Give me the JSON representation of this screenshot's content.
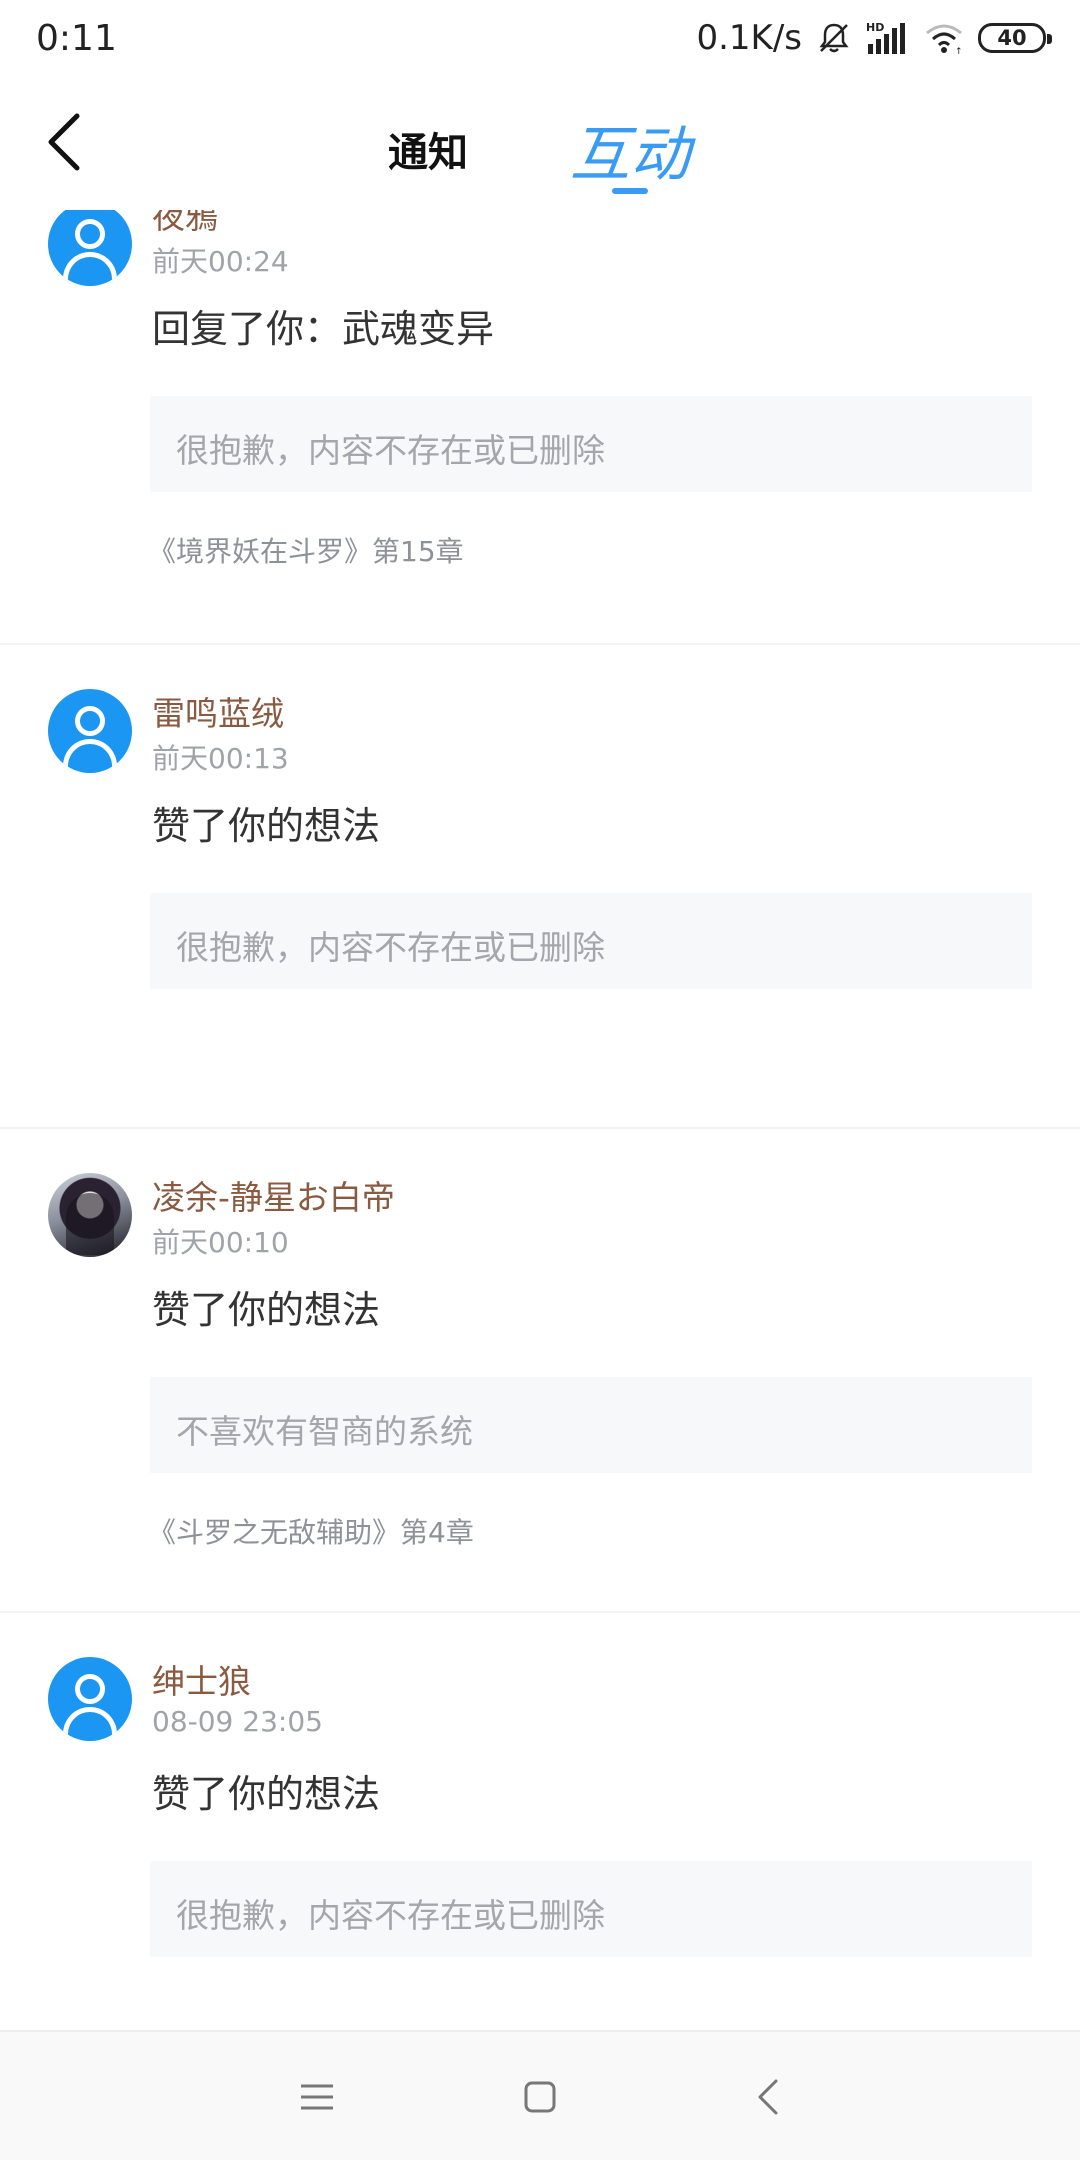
{
  "status_bar": {
    "time": "0:11",
    "net_speed": "0.1K/s",
    "battery": "40",
    "icons": [
      "bell-off-icon",
      "hd-signal-icon",
      "wifi-icon",
      "battery-icon"
    ]
  },
  "header": {
    "tab_notify": "通知",
    "tab_interact": "互动",
    "active_tab": "互动",
    "accent_color": "#3a9bf4"
  },
  "items": [
    {
      "username": "夜鴉",
      "time": "前天00:24",
      "action": "回复了你：武魂变异",
      "quote": "很抱歉，内容不存在或已删除",
      "source": "《境界妖在斗罗》第15章",
      "avatar": "default-avatar-icon"
    },
    {
      "username": "雷鸣蓝绒",
      "time": "前天00:13",
      "action": "赞了你的想法",
      "quote": "很抱歉，内容不存在或已删除",
      "source": "",
      "avatar": "default-avatar-icon"
    },
    {
      "username": "凌余-静星お白帝",
      "time": "前天00:10",
      "action": "赞了你的想法",
      "quote": "不喜欢有智商的系统",
      "source": "《斗罗之无敌辅助》第4章",
      "avatar": "photo-avatar"
    },
    {
      "username": "绅士狼",
      "time": "08-09 23:05",
      "action": "赞了你的想法",
      "quote": "很抱歉，内容不存在或已删除",
      "source": "",
      "avatar": "default-avatar-icon"
    }
  ],
  "colors": {
    "username": "#8a5a40",
    "avatar_blue": "#1b96f2",
    "quote_bg": "#f7f8f9"
  }
}
